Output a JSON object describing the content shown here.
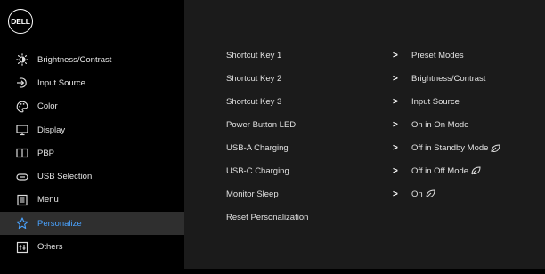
{
  "logo": {
    "text": "DELL"
  },
  "sidebar": {
    "items": [
      {
        "label": "Brightness/Contrast",
        "icon": "brightness-icon"
      },
      {
        "label": "Input Source",
        "icon": "input-source-icon"
      },
      {
        "label": "Color",
        "icon": "color-palette-icon"
      },
      {
        "label": "Display",
        "icon": "display-icon"
      },
      {
        "label": "PBP",
        "icon": "pbp-icon"
      },
      {
        "label": "USB Selection",
        "icon": "usb-icon"
      },
      {
        "label": "Menu",
        "icon": "menu-icon"
      },
      {
        "label": "Personalize",
        "icon": "star-icon",
        "active": true
      },
      {
        "label": "Others",
        "icon": "others-icon"
      }
    ]
  },
  "settings": [
    {
      "name": "Shortcut Key 1",
      "arrow": ">",
      "value": "Preset Modes"
    },
    {
      "name": "Shortcut Key 2",
      "arrow": ">",
      "value": "Brightness/Contrast"
    },
    {
      "name": "Shortcut Key 3",
      "arrow": ">",
      "value": "Input Source"
    },
    {
      "name": "Power Button LED",
      "arrow": ">",
      "value": "On in On Mode"
    },
    {
      "name": "USB-A Charging",
      "arrow": ">",
      "value": "Off in Standby Mode",
      "leaf": true
    },
    {
      "name": "USB-C Charging",
      "arrow": ">",
      "value": "Off in Off Mode",
      "leaf": true
    },
    {
      "name": "Monitor Sleep",
      "arrow": ">",
      "value": "On",
      "leaf": true
    },
    {
      "name": "Reset Personalization",
      "arrow": "",
      "value": ""
    }
  ],
  "colors": {
    "accent": "#4aa3ff",
    "active_bg": "#2f2f2f",
    "panel_bg": "#1b1b1b"
  }
}
